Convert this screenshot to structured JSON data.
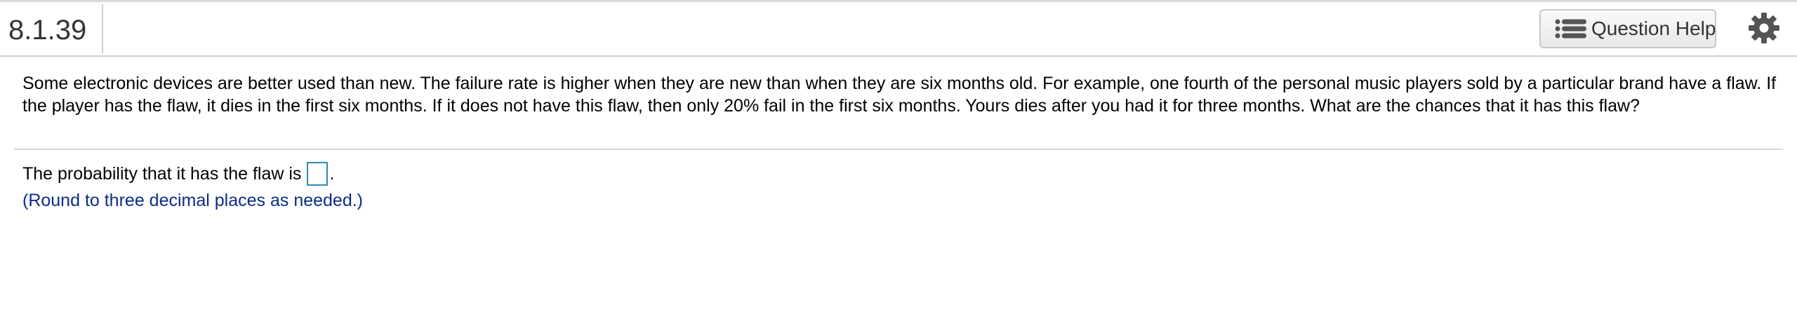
{
  "header": {
    "question_number": "8.1.39",
    "help_button_label": "Question Help",
    "help_icon": "list-icon",
    "settings_icon": "gear-icon"
  },
  "question": {
    "text": "Some electronic devices are better used than new. The failure rate is higher when they are new than when they are six months old. For example, one fourth of the personal music players sold by a particular brand have a flaw. If the player has the flaw, it dies in the first six months. If it does not have this flaw, then only 20% fail in the first six months. Yours dies after you had it for three months. What are the chances that it has this flaw?"
  },
  "answer": {
    "prompt": "The probability that it has the flaw is",
    "value": "",
    "suffix": ".",
    "hint": "(Round to three decimal places as needed.)"
  },
  "colors": {
    "hint_text": "#0b2d86",
    "answer_box_border": "#2e8ab8",
    "icon_gray": "#555555"
  }
}
